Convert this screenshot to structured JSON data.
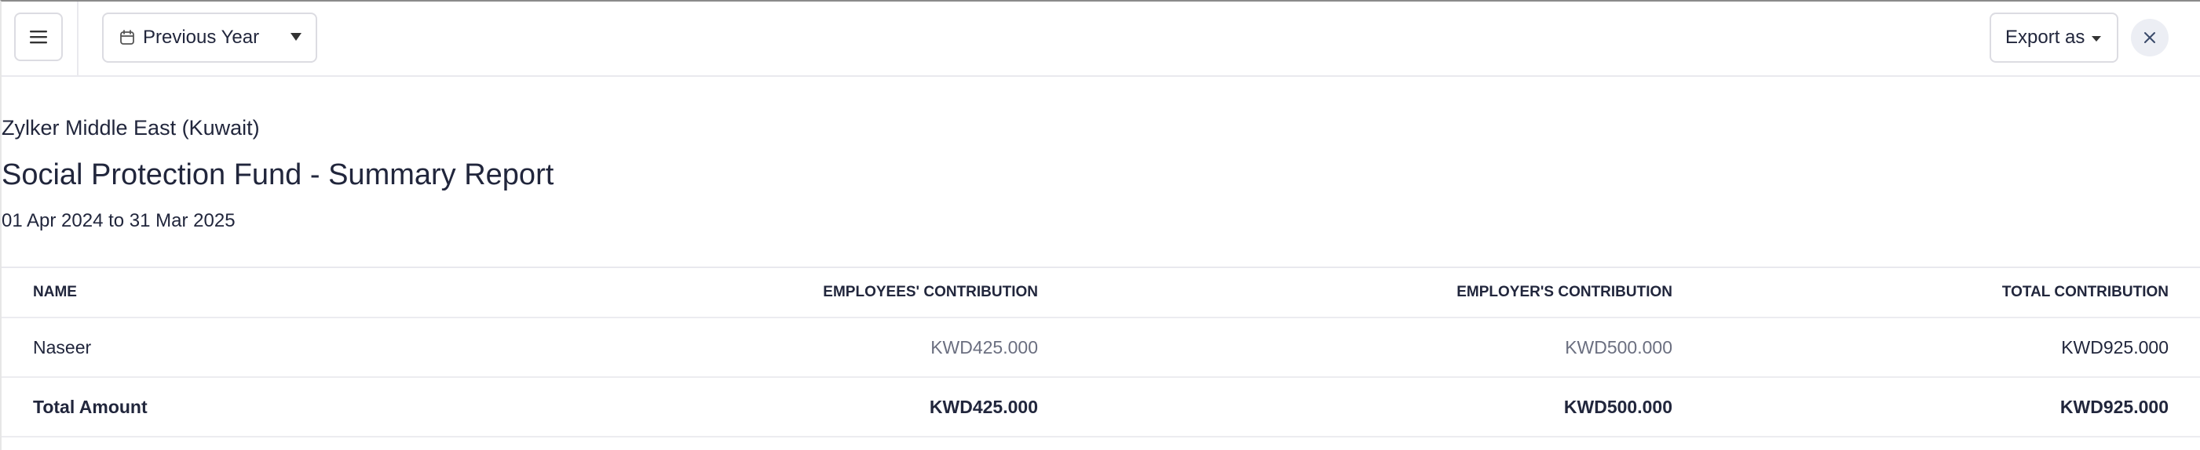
{
  "toolbar": {
    "menu_icon": "hamburger-menu-icon",
    "period": {
      "icon": "calendar-icon",
      "label": "Previous Year"
    },
    "export_label": "Export as",
    "close_icon": "close-icon"
  },
  "report": {
    "organization": "Zylker Middle East (Kuwait)",
    "title": "Social Protection Fund - Summary Report",
    "date_range": "01 Apr 2024 to 31 Mar 2025"
  },
  "table": {
    "columns": [
      "NAME",
      "EMPLOYEES' CONTRIBUTION",
      "EMPLOYER'S CONTRIBUTION",
      "TOTAL CONTRIBUTION"
    ],
    "rows": [
      {
        "name": "Naseer",
        "employees": "KWD425.000",
        "employer": "KWD500.000",
        "total": "KWD925.000"
      }
    ],
    "totals": {
      "label": "Total Amount",
      "employees": "KWD425.000",
      "employer": "KWD500.000",
      "total": "KWD925.000"
    }
  },
  "colors": {
    "text": "#21263c",
    "muted": "#6b6f80",
    "border": "#e9e9ee",
    "close_bg": "#eceef4"
  }
}
